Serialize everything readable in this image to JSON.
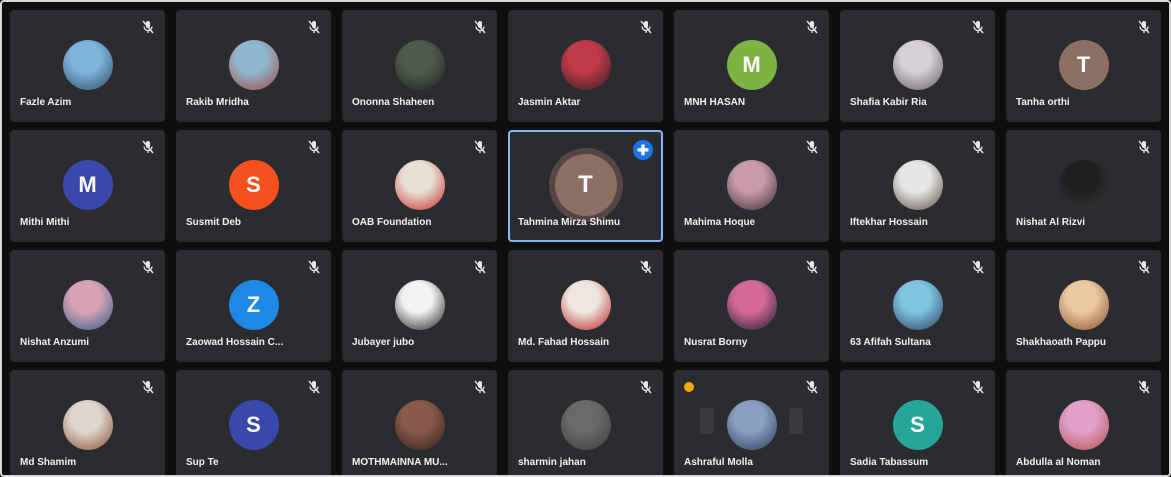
{
  "participants": [
    {
      "name": "Fazle Azim",
      "avatar": "photo",
      "c1": "#7fb3d9",
      "c2": "#2e4b6a"
    },
    {
      "name": "Rakib Mridha",
      "avatar": "photo",
      "c1": "#8fb8d0",
      "c2": "#a14a3e"
    },
    {
      "name": "Ononna Shaheen",
      "avatar": "photo",
      "c1": "#4d5c4a",
      "c2": "#1f2420"
    },
    {
      "name": "Jasmin Aktar",
      "avatar": "photo",
      "c1": "#c03a47",
      "c2": "#2a1e24"
    },
    {
      "name": "MNH HASAN",
      "avatar": "letter",
      "letter": "M",
      "color": "#7cb342"
    },
    {
      "name": "Shafia Kabir Ria",
      "avatar": "photo",
      "c1": "#d4d0d6",
      "c2": "#6a5a60"
    },
    {
      "name": "Tanha orthi",
      "avatar": "letter",
      "letter": "T",
      "color": "#8d6e63"
    },
    {
      "name": "Mithi Mithi",
      "avatar": "letter",
      "letter": "M",
      "color": "#3949ab"
    },
    {
      "name": "Susmit Deb",
      "avatar": "letter",
      "letter": "S",
      "color": "#f4511e"
    },
    {
      "name": "OAB Foundation",
      "avatar": "photo",
      "c1": "#e8e0d4",
      "c2": "#c62828"
    },
    {
      "name": "Tahmina Mirza Shimu",
      "avatar": "letter",
      "letter": "T",
      "color": "#8d6e63",
      "active": true
    },
    {
      "name": "Mahima Hoque",
      "avatar": "photo",
      "c1": "#c99aa8",
      "c2": "#3a2a30"
    },
    {
      "name": "Iftekhar Hossain",
      "avatar": "photo",
      "c1": "#e6e6e6",
      "c2": "#5a4a3a"
    },
    {
      "name": "Nishat Al Rizvi",
      "avatar": "photo",
      "c1": "#1e1e20",
      "c2": "#3a3a3e"
    },
    {
      "name": "Nishat Anzumi",
      "avatar": "photo",
      "c1": "#d8a4b4",
      "c2": "#2a5a8a"
    },
    {
      "name": "Zaowad Hossain C...",
      "avatar": "letter",
      "letter": "Z",
      "color": "#1e88e5"
    },
    {
      "name": "Jubayer jubo",
      "avatar": "photo",
      "c1": "#f2f2f2",
      "c2": "#1a1a1a"
    },
    {
      "name": "Md. Fahad Hossain",
      "avatar": "photo",
      "c1": "#f0e6e0",
      "c2": "#b71c1c"
    },
    {
      "name": "Nusrat Borny",
      "avatar": "photo",
      "c1": "#d46a9a",
      "c2": "#1a1a2a"
    },
    {
      "name": "63 Afifah Sultana",
      "avatar": "photo",
      "c1": "#7fc4e0",
      "c2": "#2a3a5a"
    },
    {
      "name": "Shakhaoath Pappu",
      "avatar": "photo",
      "c1": "#e9c9a0",
      "c2": "#8a4a2a"
    },
    {
      "name": "Md Shamim",
      "avatar": "photo",
      "c1": "#dcd6cc",
      "c2": "#8a4a30"
    },
    {
      "name": "Sup Te",
      "avatar": "letter",
      "letter": "S",
      "color": "#3949ab"
    },
    {
      "name": "MOTHMAINNA MU...",
      "avatar": "photo",
      "c1": "#8a5a4a",
      "c2": "#2a1e1a"
    },
    {
      "name": "sharmin jahan",
      "avatar": "photo",
      "c1": "#6a6a6a",
      "c2": "#3a3a3a"
    },
    {
      "name": "Ashraful Molla",
      "avatar": "photo",
      "c1": "#8aa0c0",
      "c2": "#2a3a5a",
      "hand": true
    },
    {
      "name": "Sadia Tabassum",
      "avatar": "letter",
      "letter": "S",
      "color": "#26a69a"
    },
    {
      "name": "Abdulla al Noman",
      "avatar": "photo",
      "c1": "#e0a0c8",
      "c2": "#b0504a"
    }
  ]
}
